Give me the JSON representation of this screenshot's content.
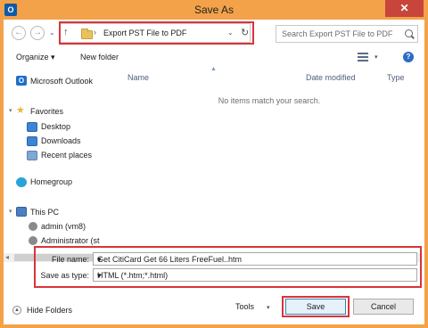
{
  "window": {
    "title": "Save As",
    "close_symbol": "✕",
    "app_icon": "O"
  },
  "address": {
    "up_symbol": "↑",
    "separator": "›",
    "path": "Export PST File to PDF",
    "dropdown_symbol": "⌄",
    "refresh_symbol": "↻"
  },
  "search": {
    "placeholder": "Search Export PST File to PDF"
  },
  "toolbar": {
    "organize": "Organize ▾",
    "new_folder": "New folder",
    "help": "?"
  },
  "nav": {
    "back_symbol": "←",
    "forward_symbol": "→",
    "history_symbol": "⌄",
    "outlook": "Microsoft Outlook",
    "favorites": "Favorites",
    "desktop": "Desktop",
    "downloads": "Downloads",
    "recent": "Recent places",
    "homegroup": "Homegroup",
    "this_pc": "This PC",
    "admin": "admin (vm8)",
    "administrator": "Administrator (st"
  },
  "columns": {
    "name": "Name",
    "date_modified": "Date modified",
    "type": "Type"
  },
  "content": {
    "empty_message": "No items match your search."
  },
  "form": {
    "file_name_label": "File name:",
    "file_name_value": "Get CitiCard Get 66 Liters FreeFuel..htm",
    "save_type_label": "Save as type:",
    "save_type_value": "HTML (*.htm;*.html)"
  },
  "footer": {
    "hide_folders": "Hide Folders",
    "tools": "Tools",
    "save": "Save",
    "cancel": "Cancel"
  },
  "colors": {
    "titlebar": "#f3a24a",
    "close": "#c7453a",
    "highlight": "#d9343a"
  }
}
